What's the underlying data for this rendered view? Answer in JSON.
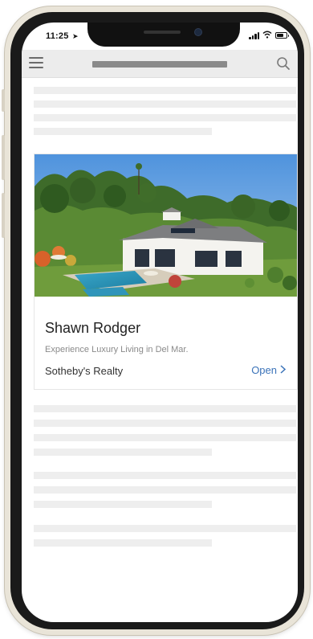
{
  "status_bar": {
    "time": "11:25",
    "location_icon": "location-arrow-icon",
    "battery_level": 0.7
  },
  "navbar": {
    "menu_icon": "hamburger-menu-icon",
    "search_icon": "search-icon"
  },
  "ad_card": {
    "title": "Shawn Rodger",
    "subtitle": "Experience Luxury Living in Del Mar.",
    "advertiser": "Sotheby's Realty",
    "cta_label": "Open",
    "cta_icon": "chevron-right-icon",
    "image": "luxury-house-with-pool-photo"
  },
  "colors": {
    "accent": "#3b73b9",
    "skeleton": "#eeeeee",
    "navbar": "#ececec"
  }
}
